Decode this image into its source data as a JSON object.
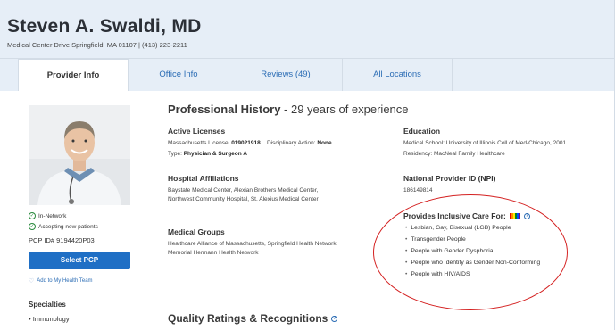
{
  "provider": {
    "name": "Steven A. Swaldi, MD",
    "address": "Medical Center Drive Springfield, MA 01107  |  (413) 223-2211"
  },
  "tabs": [
    {
      "label": "Provider Info",
      "active": true
    },
    {
      "label": "Office Info",
      "active": false
    },
    {
      "label": "Reviews (49)",
      "active": false
    },
    {
      "label": "All Locations",
      "active": false
    }
  ],
  "sidebar": {
    "in_network": "In-Network",
    "accepting": "Accepting new patients",
    "pcp_id": "PCP ID# 9194420P03",
    "select_pcp": "Select PCP",
    "add_team": "Add to My Health Team",
    "specialties_title": "Specialties",
    "specialties": [
      "Immunology"
    ]
  },
  "history": {
    "title_bold": "Professional History",
    "title_rest": " - 29 years of experience",
    "licenses_title": "Active Licenses",
    "license_label": "Massachusetts License: ",
    "license_value": "019021918",
    "disciplinary_label": "Disciplinary Action: ",
    "disciplinary_value": "None",
    "type_label": "Type: ",
    "type_value": "Physician & Surgeon A",
    "education_title": "Education",
    "medical_school": "Medical School: University of Illinois Coll of Med-Chicago, 2001",
    "residency": "Residency: MacNeal Family Healthcare",
    "hospital_title": "Hospital Affiliations",
    "hospital_text": "Baystate Medical Center, Alexian Brothers Medical Center, Northwest Community Hospital, St. Alexius Medical Center",
    "npi_title": "National Provider ID (NPI)",
    "npi_value": "186149814",
    "groups_title": "Medical Groups",
    "groups_text": "Healthcare Alliance of Massachusetts, Springfield Health Network, Memorial Hermann Health Network"
  },
  "inclusive": {
    "title": "Provides Inclusive Care For:",
    "items": [
      "Lesbian, Gay, Bisexual (LGB) People",
      "Transgender People",
      "People with Gender Dysphoria",
      "People who Identify as Gender Non-Conforming",
      "People with HIV/AIDS"
    ],
    "flag_colors": [
      "#e40303",
      "#ff8c00",
      "#ffed00",
      "#008026",
      "#004dff",
      "#750787"
    ],
    "highlight_color": "#d42020"
  },
  "quality": {
    "title": "Quality Ratings & Recognitions"
  },
  "colors": {
    "header_bg": "#e6eef7",
    "link": "#2c6db5",
    "button": "#1f6fc5",
    "network_green": "#2a8a3e"
  }
}
